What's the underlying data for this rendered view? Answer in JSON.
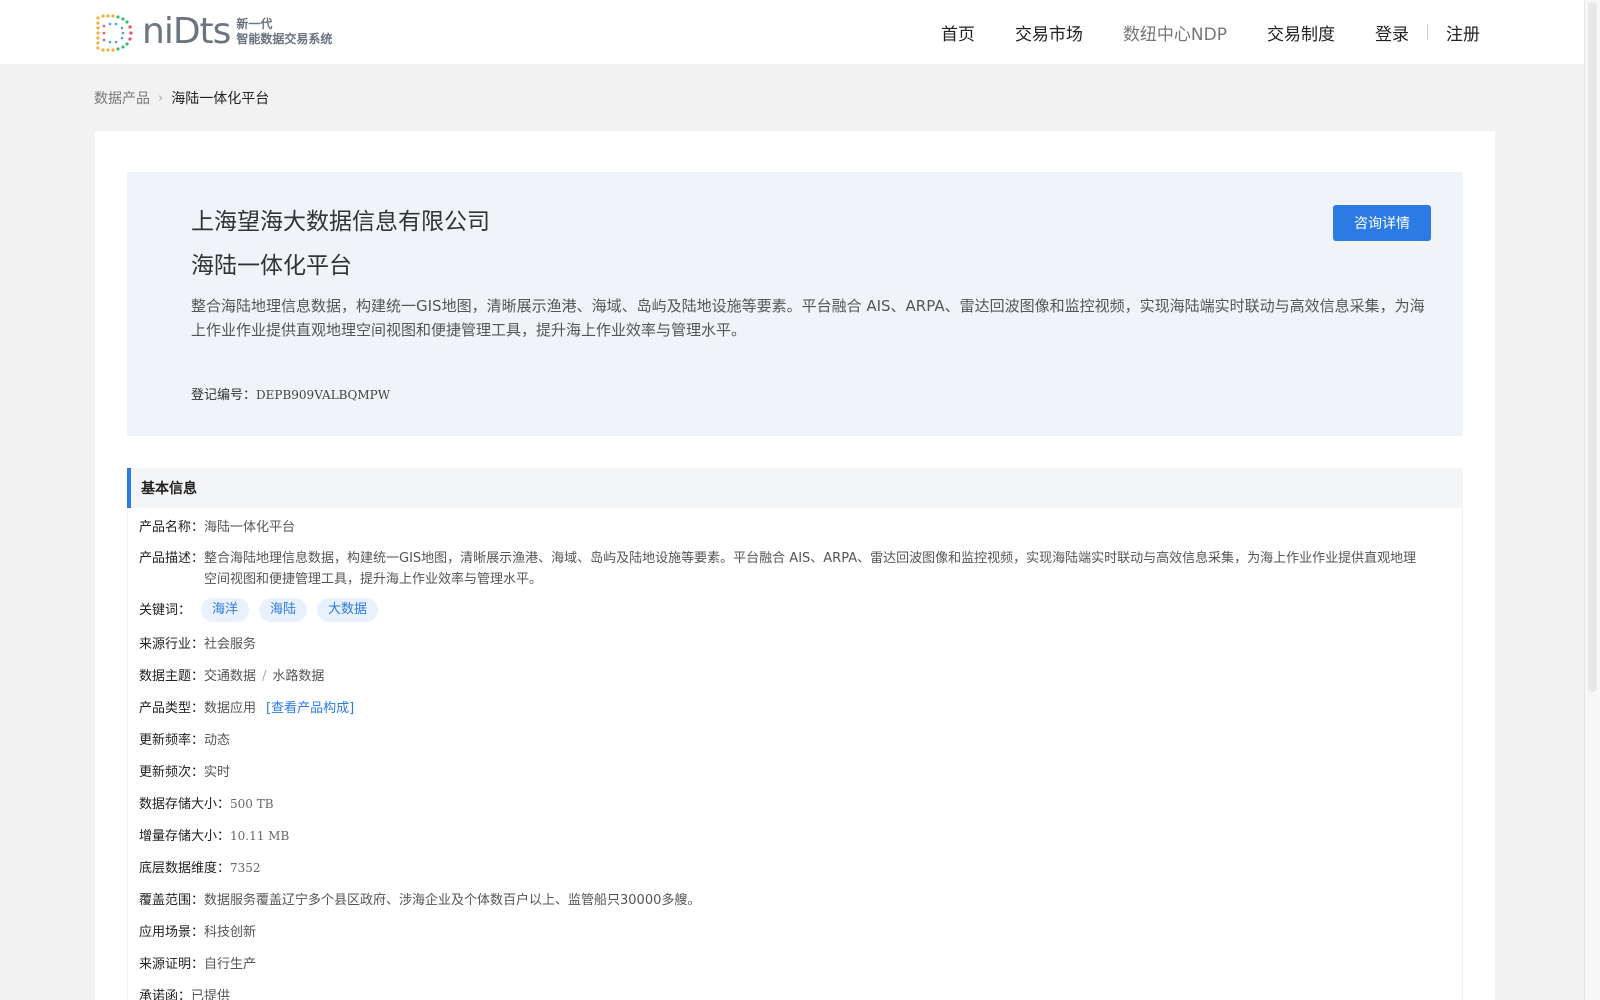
{
  "header": {
    "logo_word": "niDts",
    "logo_sub_1": "新一代",
    "logo_sub_2": "智能数据交易系统",
    "nav": [
      "首页",
      "交易市场",
      "数纽中心NDP",
      "交易制度",
      "登录",
      "注册"
    ]
  },
  "breadcrumb": {
    "parent": "数据产品",
    "current": "海陆一体化平台"
  },
  "hero": {
    "company": "上海望海大数据信息有限公司",
    "product": "海陆一体化平台",
    "description": "整合海陆地理信息数据，构建统一GIS地图，清晰展示渔港、海域、岛屿及陆地设施等要素。平台融合 AIS、ARPA、雷达回波图像和监控视频，实现海陆端实时联动与高效信息采集，为海上作业作业提供直观地理空间视图和便捷管理工具，提升海上作业效率与管理水平。",
    "regno_label": "登记编号：",
    "regno_value": "DEPB909VALBQMPW",
    "consult_label": "咨询详情"
  },
  "basic": {
    "title": "基本信息",
    "name_label": "产品名称：",
    "name_value": "海陆一体化平台",
    "desc_label": "产品描述：",
    "desc_value": "整合海陆地理信息数据，构建统一GIS地图，清晰展示渔港、海域、岛屿及陆地设施等要素。平台融合 AIS、ARPA、雷达回波图像和监控视频，实现海陆端实时联动与高效信息采集，为海上作业作业提供直观地理空间视图和便捷管理工具，提升海上作业效率与管理水平。",
    "keywords_label": "关键词：",
    "keywords": [
      "海洋",
      "海陆",
      "大数据"
    ],
    "industry_label": "来源行业：",
    "industry_value": "社会服务",
    "topic_label": "数据主题：",
    "topic_value_1": "交通数据",
    "topic_sep": "/",
    "topic_value_2": "水路数据",
    "type_label": "产品类型：",
    "type_value": "数据应用",
    "type_link": "[查看产品构成]",
    "freq_label": "更新频率：",
    "freq_value": "动态",
    "times_label": "更新频次：",
    "times_value": "实时",
    "storage_label": "数据存储大小：",
    "storage_value": "500 TB",
    "increment_label": "增量存储大小：",
    "increment_value": "10.11 MB",
    "dims_label": "底层数据维度：",
    "dims_value": "7352",
    "coverage_label": "覆盖范围：",
    "coverage_value": "数据服务覆盖辽宁多个县区政府、涉海企业及个体数百户以上、监管船只30000多艘。",
    "scene_label": "应用场景：",
    "scene_value": "科技创新",
    "proof_label": "来源证明：",
    "proof_value": "自行生产",
    "promise_label": "承诺函：",
    "promise_value": "已提供"
  }
}
